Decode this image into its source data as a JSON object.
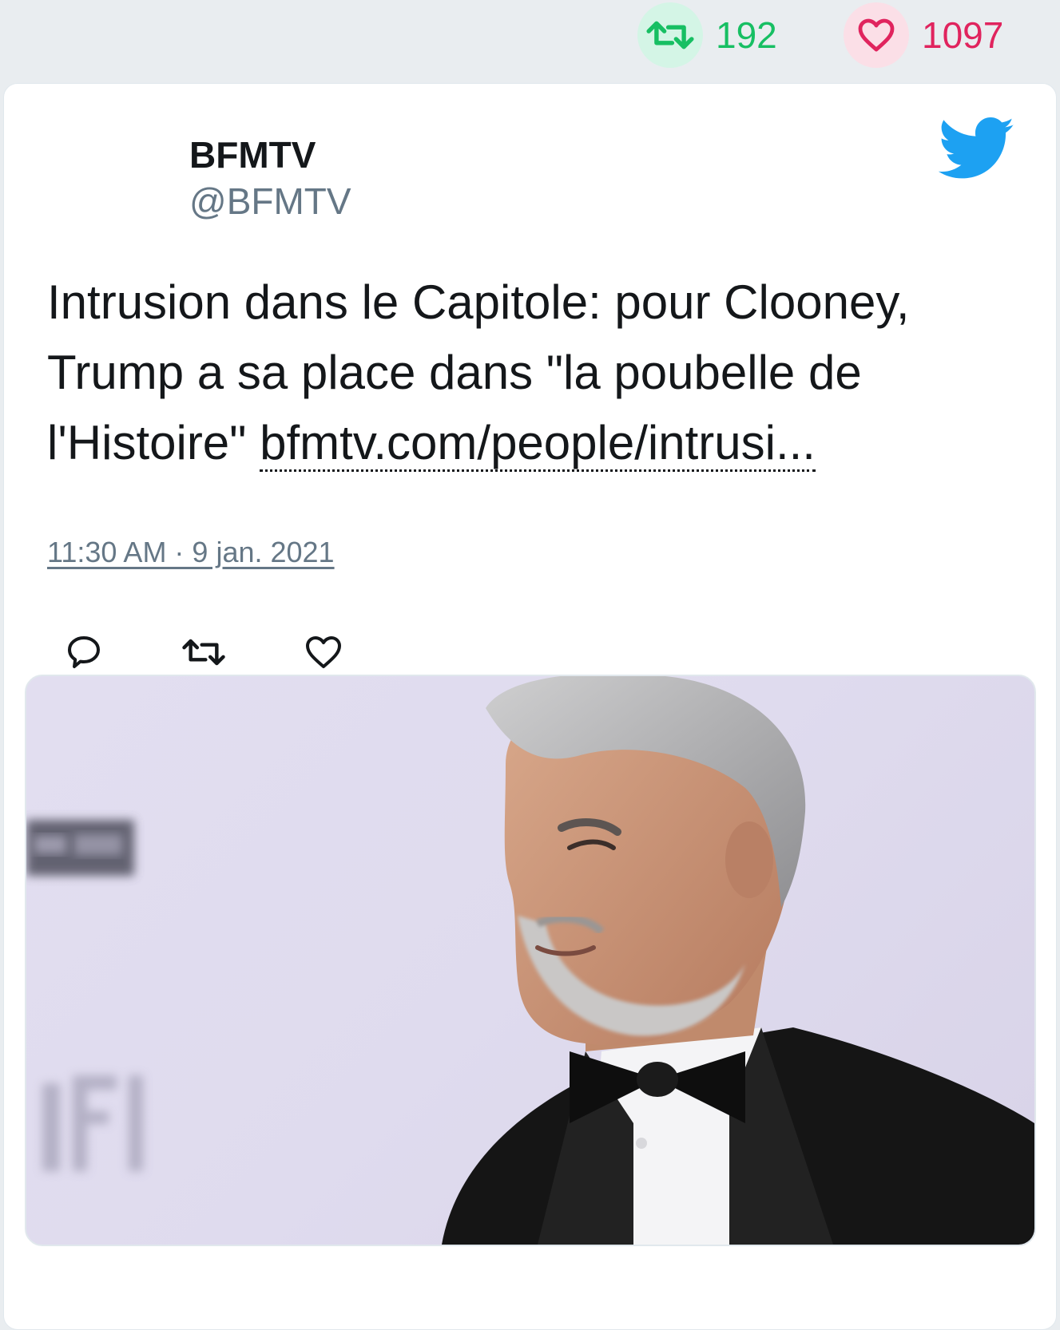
{
  "stats": {
    "retweets": "192",
    "likes": "1097",
    "retweet_color": "#17bf63",
    "like_color": "#e0245e"
  },
  "tweet": {
    "user_name": "BFMTV",
    "handle": "@BFMTV",
    "text": "Intrusion dans le Capitole: pour Clooney, Trump a sa place dans \"la poubelle de l'Histoire\" ",
    "link_text": "bfmtv.com/people/intrusi...",
    "timestamp": "11:30 AM · 9 jan. 2021"
  },
  "icons": {
    "brand": "twitter-bird-icon",
    "actions": [
      "reply-icon",
      "retweet-icon",
      "like-icon"
    ]
  },
  "colors": {
    "twitter_blue": "#1da1f2",
    "text": "#14171a",
    "secondary_text": "#657786"
  }
}
